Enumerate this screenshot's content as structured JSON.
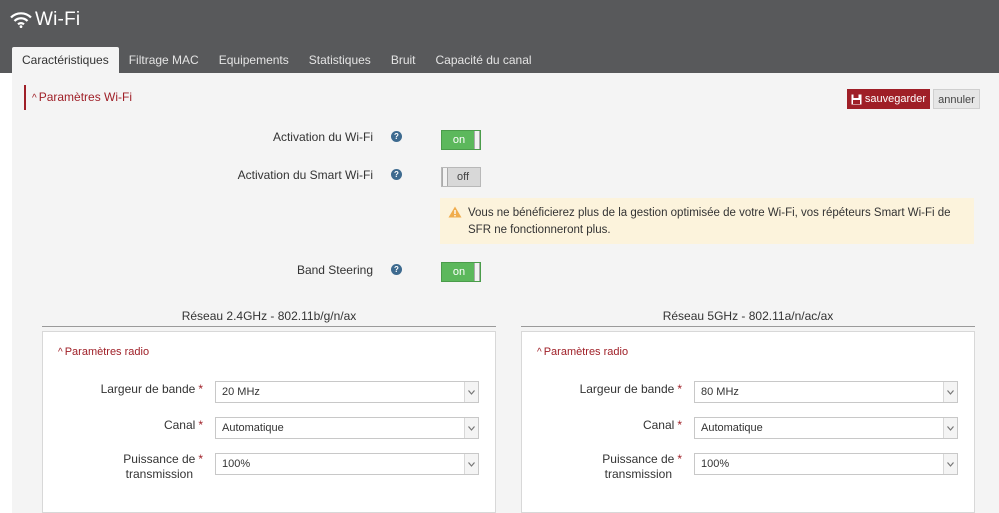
{
  "app": {
    "title": "Wi-Fi",
    "icon": "wifi-icon"
  },
  "tabs": [
    {
      "label": "Caractéristiques",
      "active": true
    },
    {
      "label": "Filtrage MAC"
    },
    {
      "label": "Equipements"
    },
    {
      "label": "Statistiques"
    },
    {
      "label": "Bruit"
    },
    {
      "label": "Capacité du canal"
    }
  ],
  "section": {
    "title": "Paramètres Wi-Fi"
  },
  "actions": {
    "save_label": "sauvegarder",
    "cancel_label": "annuler"
  },
  "settings": {
    "wifi_activation": {
      "label": "Activation du Wi-Fi",
      "state": "on"
    },
    "smart_wifi": {
      "label": "Activation du Smart Wi-Fi",
      "state": "off"
    },
    "warning": "Vous ne bénéficierez plus de la gestion optimisée de votre Wi-Fi, vos répéteurs Smart Wi-Fi de SFR ne fonctionneront plus.",
    "band_steering": {
      "label": "Band Steering",
      "state": "on"
    },
    "help_glyph": "?"
  },
  "networks": [
    {
      "title": "Réseau 2.4GHz - 802.11b/g/n/ax",
      "radio_title": "Paramètres radio",
      "bandwidth": {
        "label": "Largeur de bande",
        "value": "20 MHz"
      },
      "channel": {
        "label": "Canal",
        "value": "Automatique"
      },
      "power": {
        "label_line1": "Puissance de",
        "label_line2": "transmission",
        "value": "100%"
      }
    },
    {
      "title": "Réseau 5GHz - 802.11a/n/ac/ax",
      "radio_title": "Paramètres radio",
      "bandwidth": {
        "label": "Largeur de bande",
        "value": "80 MHz"
      },
      "channel": {
        "label": "Canal",
        "value": "Automatique"
      },
      "power": {
        "label_line1": "Puissance de",
        "label_line2": "transmission",
        "value": "100%"
      }
    }
  ],
  "required_mark": "*",
  "colors": {
    "topbar": "#58595b",
    "accent": "#9f1f27",
    "toggle_on": "#5cb85c",
    "warning_bg": "#fcf3dc",
    "help": "#3d6a8f"
  }
}
